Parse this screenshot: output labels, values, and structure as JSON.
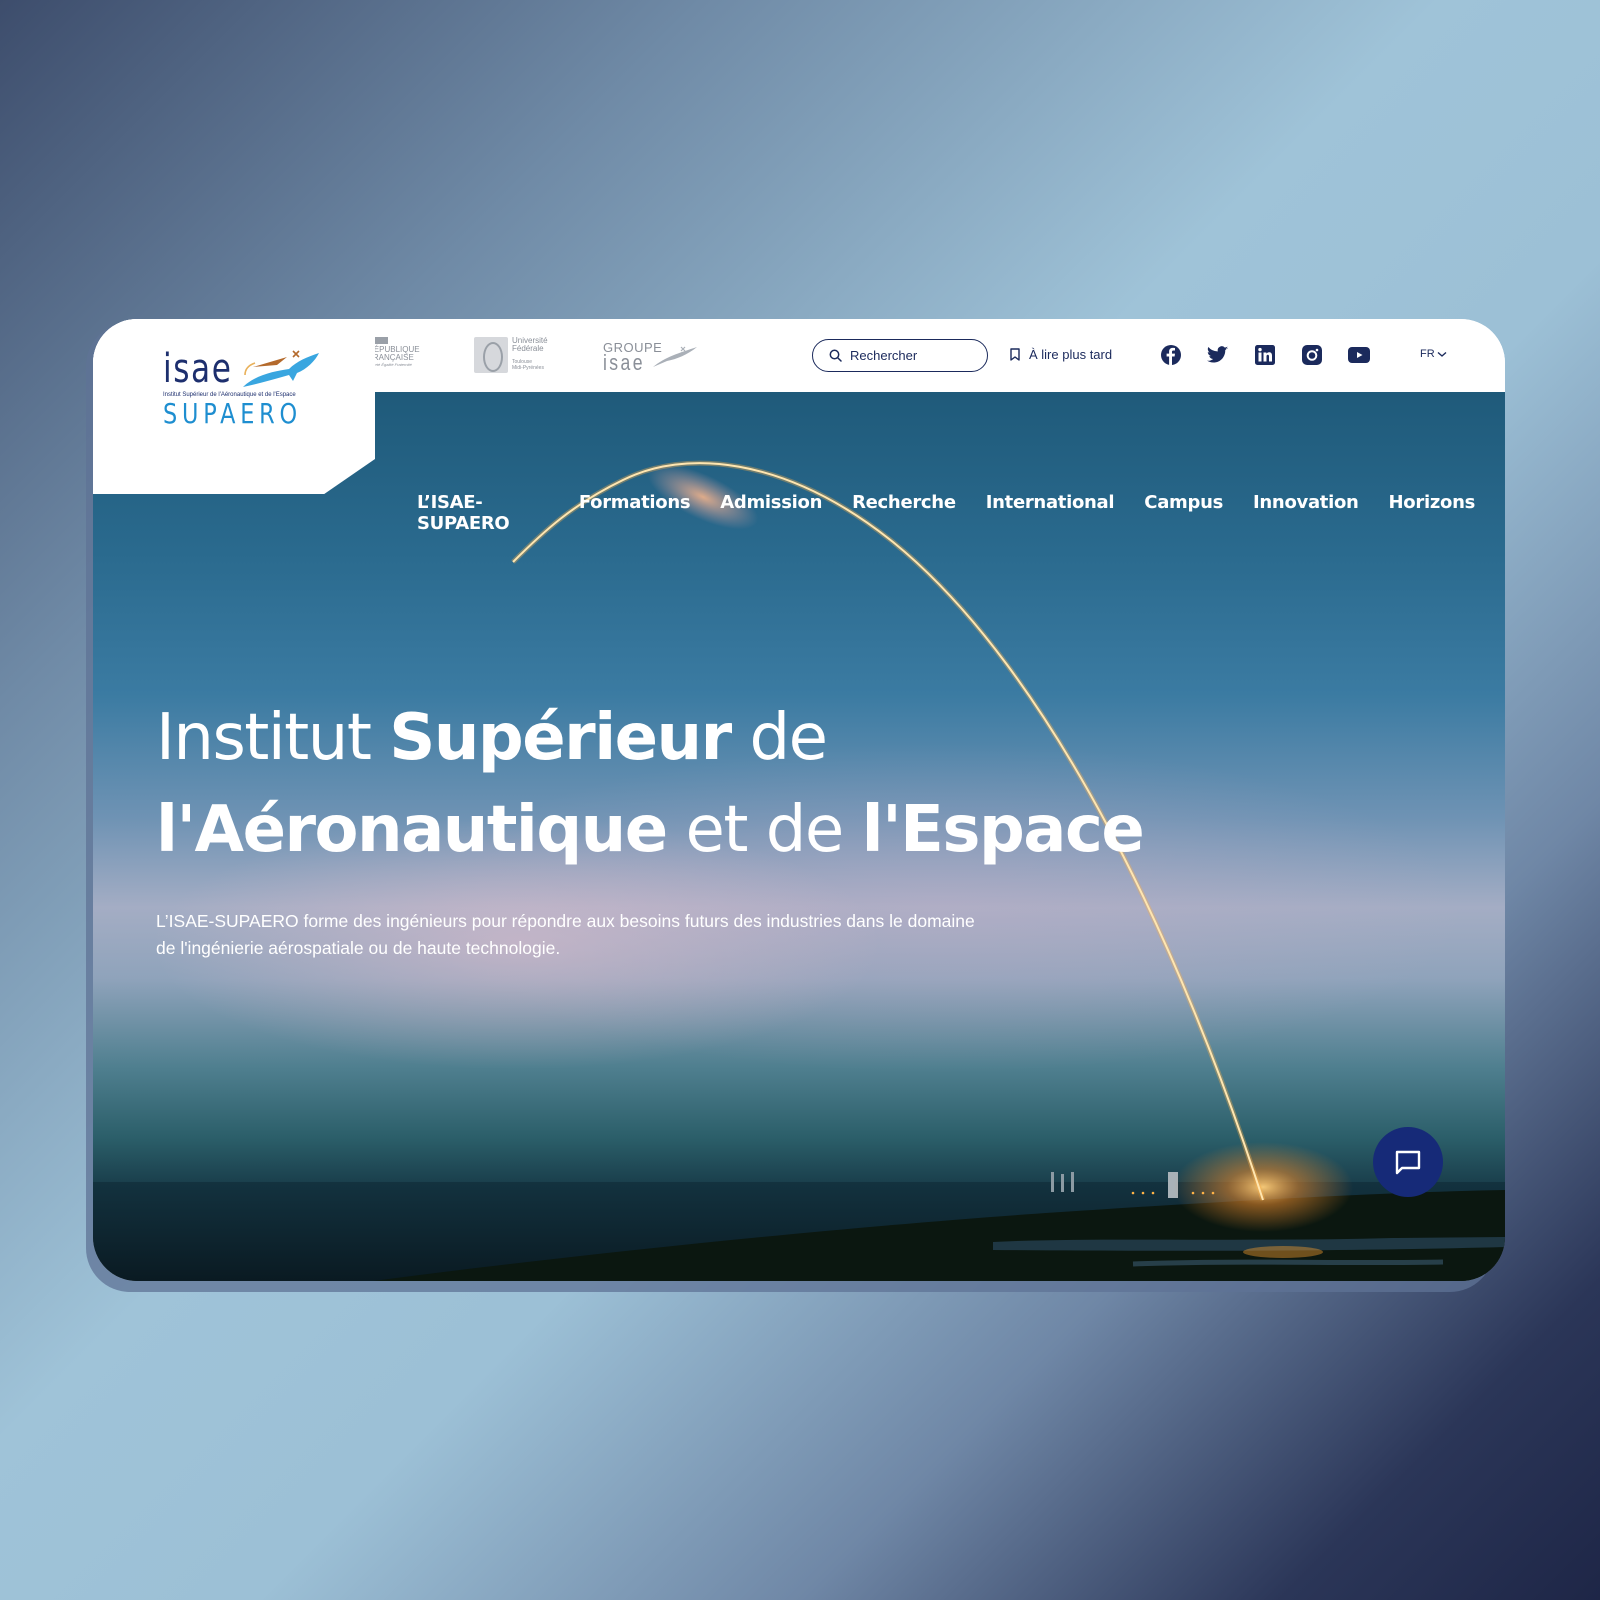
{
  "header": {
    "logo": {
      "wordmark": "isae",
      "tagline": "Institut Supérieur de l'Aéronautique et de l'Espace",
      "subwordmark": "SUPAERO"
    },
    "partners": {
      "republique": {
        "line1": "RÉPUBLIQUE",
        "line2": "FRANÇAISE",
        "motto": "Liberté Égalité Fraternité"
      },
      "universite": {
        "line1": "Université",
        "line2": "Fédérale",
        "line3": "Toulouse",
        "line4": "Midi-Pyrénées"
      },
      "groupe": {
        "line1": "GROUPE",
        "line2": "isae"
      }
    },
    "search": {
      "placeholder": "Rechercher",
      "value": ""
    },
    "read_later": "À lire plus tard",
    "social": [
      {
        "name": "facebook",
        "icon": "facebook-icon"
      },
      {
        "name": "twitter",
        "icon": "twitter-icon"
      },
      {
        "name": "linkedin",
        "icon": "linkedin-icon"
      },
      {
        "name": "instagram",
        "icon": "instagram-icon"
      },
      {
        "name": "youtube",
        "icon": "youtube-icon"
      }
    ],
    "language": "FR"
  },
  "nav": {
    "items": [
      {
        "label": "L’ISAE-SUPAERO"
      },
      {
        "label": "Formations"
      },
      {
        "label": "Admission"
      },
      {
        "label": "Recherche"
      },
      {
        "label": "International"
      },
      {
        "label": "Campus"
      },
      {
        "label": "Innovation"
      },
      {
        "label": "Horizons"
      }
    ]
  },
  "hero": {
    "title": {
      "w1": "Institut ",
      "w2": "Supérieur",
      "w3": " de",
      "w4": "l'Aéronautique",
      "w5": " et de ",
      "w6": "l'Espace"
    },
    "description": "L’ISAE-SUPAERO forme des ingénieurs pour répondre aux besoins futurs des industries dans le domaine de l'ingénierie aérospatiale ou de haute technologie."
  },
  "chat": {
    "icon": "chat-icon"
  },
  "colors": {
    "brand_navy": "#1b2a5c",
    "chat_button": "#162a78",
    "logo_blue": "#1e8ed0",
    "trail_orange": "#ffb347"
  }
}
